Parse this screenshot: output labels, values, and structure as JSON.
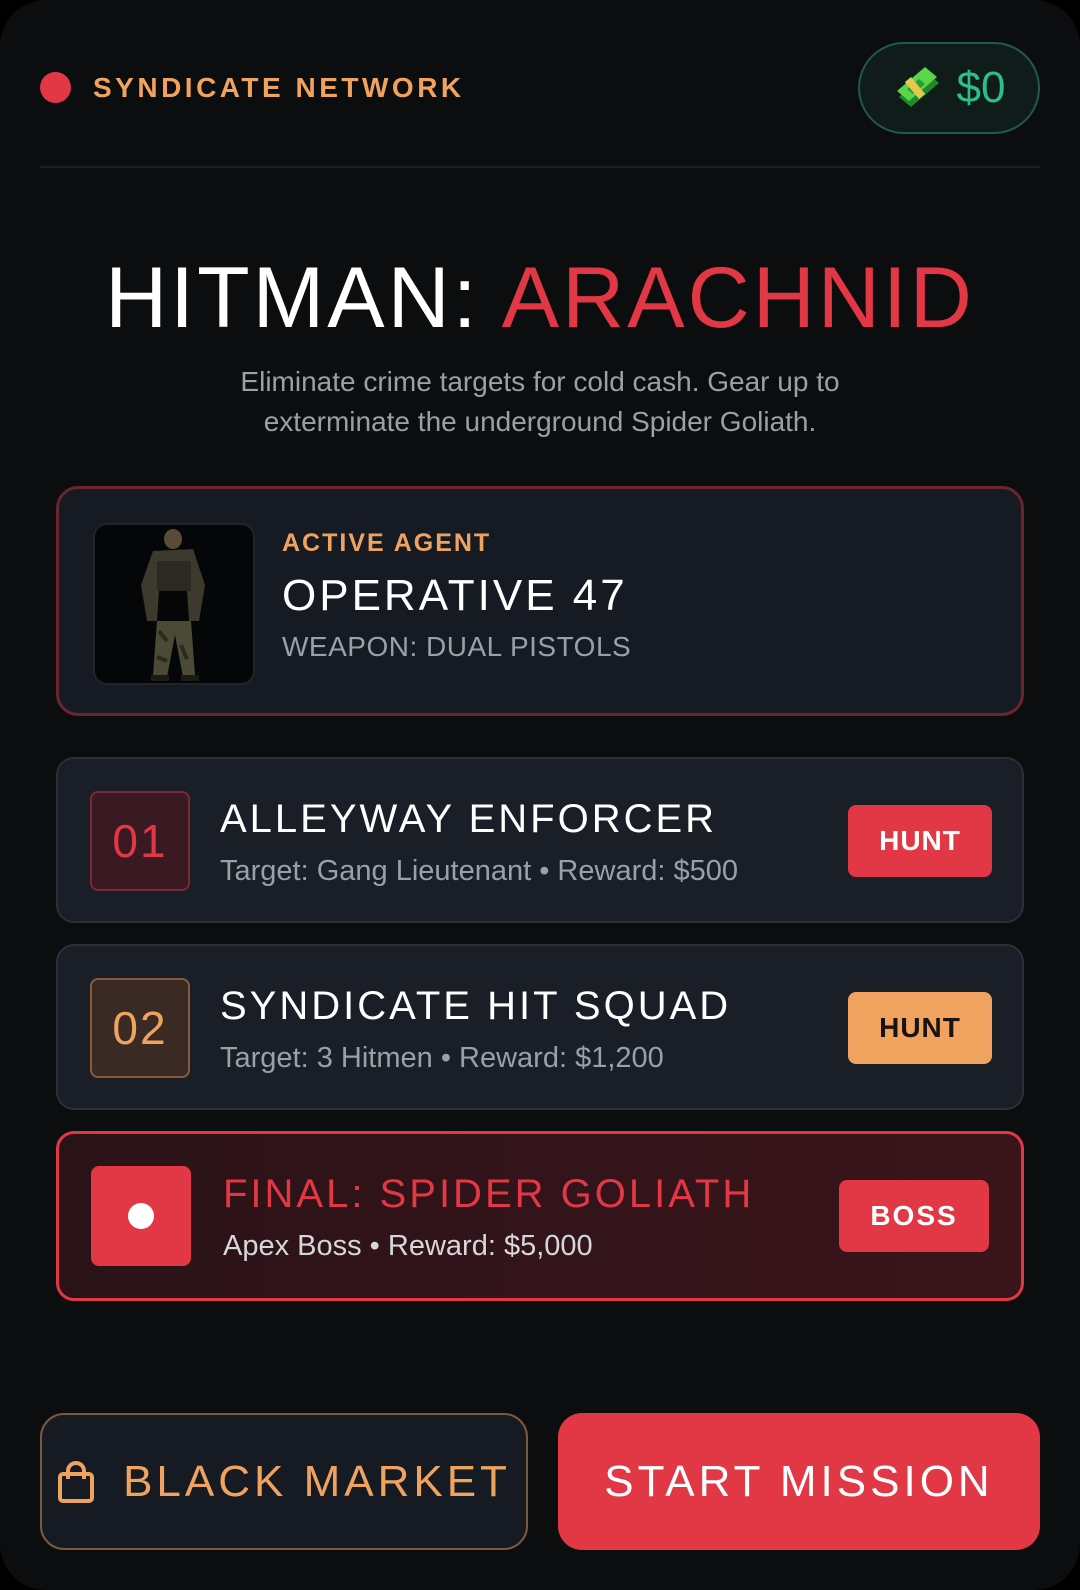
{
  "header": {
    "brand": "SYNDICATE NETWORK",
    "cash": "$0",
    "cash_icon": "money-icon"
  },
  "hero": {
    "title_main": "HITMAN: ",
    "title_accent": "ARACHNID",
    "subtitle": "Eliminate crime targets for cold cash. Gear up to exterminate the underground Spider Goliath."
  },
  "agent": {
    "label": "ACTIVE AGENT",
    "name": "OPERATIVE 47",
    "weapon": "WEAPON: DUAL PISTOLS"
  },
  "missions": [
    {
      "number": "01",
      "title": "ALLEYWAY ENFORCER",
      "subtitle": "Target: Gang Lieutenant • Reward: $500",
      "action": "HUNT"
    },
    {
      "number": "02",
      "title": "SYNDICATE HIT SQUAD",
      "subtitle": "Target: 3 Hitmen • Reward: $1,200",
      "action": "HUNT"
    }
  ],
  "boss": {
    "title": "FINAL: SPIDER GOLIATH",
    "subtitle": "Apex Boss • Reward: $5,000",
    "action": "BOSS"
  },
  "footer": {
    "market_label": "BLACK MARKET",
    "start_label": "START MISSION"
  },
  "colors": {
    "accent_red": "#e23744",
    "accent_orange": "#f0a35e",
    "cash_green": "#2dbf88",
    "background": "#0c0d0f"
  }
}
